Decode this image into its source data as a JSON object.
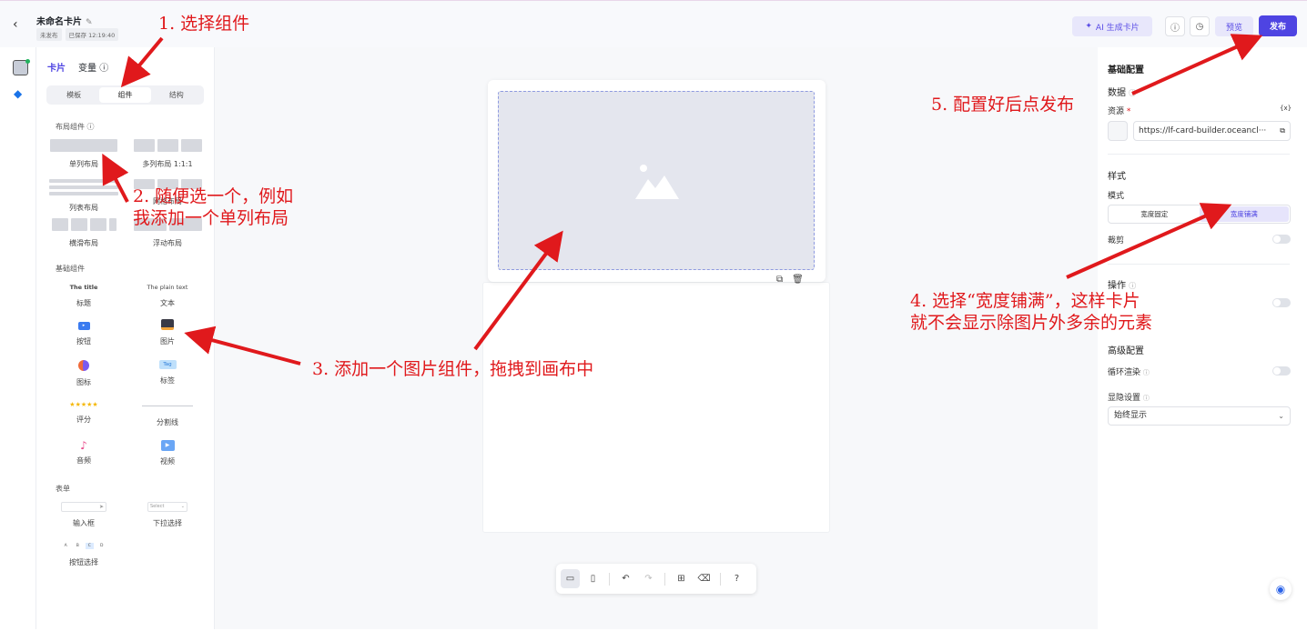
{
  "header": {
    "back_icon": "chevron-left-icon",
    "title": "未命名卡片",
    "status_tag": "未发布",
    "saved_tag": "已保存 12:19:40",
    "ai_button": "AI 生成卡片",
    "preview_button": "预览",
    "publish_button": "发布"
  },
  "left_panel": {
    "tabs": [
      "卡片",
      "变量"
    ],
    "segment": [
      "模板",
      "组件",
      "结构"
    ],
    "layout_section": "布局组件",
    "layout": [
      "单列布局",
      "多列布局 1:1:1",
      "列表布局",
      "网格布局",
      "横滑布局",
      "浮动布局"
    ],
    "basic_section": "基础组件",
    "title_sample": "The title",
    "text_sample": "The plain text",
    "tag_sample": "Tag",
    "basic": [
      "标题",
      "文本",
      "按钮",
      "图片",
      "图标",
      "标签",
      "评分",
      "分割线",
      "音频",
      "视频"
    ],
    "form_section": "表单",
    "select_sample": "Select",
    "form": [
      "输入框",
      "下拉选择",
      "按钮选择"
    ],
    "btn_select_options": [
      "A",
      "B",
      "C",
      "D"
    ]
  },
  "right_panel": {
    "basic_config": "基础配置",
    "data_label": "数据",
    "source_label": "资源",
    "source_url": "https://lf-card-builder.oceancl···",
    "var_button": "{x}",
    "style_label": "样式",
    "mode_label": "模式",
    "mode_options": [
      "宽度固定",
      "宽度铺满"
    ],
    "mode_selected": "宽度铺满",
    "crop_label": "裁剪",
    "action_label": "操作",
    "advanced_label": "高级配置",
    "loop_label": "循环渲染",
    "visibility_label": "显隐设置",
    "visibility_value": "始终显示"
  },
  "annotations": {
    "a1": "1. 选择组件",
    "a2_line1": "2. 随便选一个，例如",
    "a2_line2": "我添加一个单列布局",
    "a3": "3. 添加一个图片组件，拖拽到画布中",
    "a4_line1": "4. 选择“宽度铺满”，这样卡片",
    "a4_line2": "就不会显示除图片外多余的元素",
    "a5": "5. 配置好后点发布"
  },
  "colors": {
    "accent": "#4e44e2",
    "annotation": "#e0191c"
  }
}
